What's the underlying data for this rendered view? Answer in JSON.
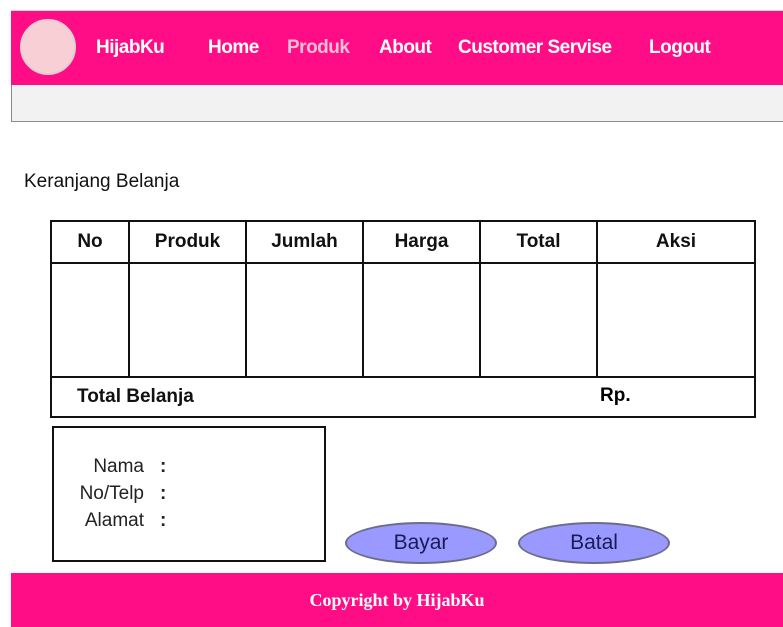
{
  "navbar": {
    "brand": "HijabKu",
    "links": [
      {
        "label": "Home",
        "active": false
      },
      {
        "label": "Produk",
        "active": true
      },
      {
        "label": "About",
        "active": false
      },
      {
        "label": "Customer Servise",
        "active": false
      },
      {
        "label": "Logout",
        "active": false
      }
    ],
    "colors": {
      "background": "#ff0d86",
      "active_link": "#f6bfd6",
      "logo_fill": "#f9cfd6"
    }
  },
  "cart": {
    "title": "Keranjang Belanja",
    "columns": [
      "No",
      "Produk",
      "Jumlah",
      "Harga",
      "Total",
      "Aksi"
    ],
    "total_label": "Total Belanja",
    "total_currency": "Rp."
  },
  "customer": {
    "fields": [
      {
        "label": "Nama",
        "sep": ":"
      },
      {
        "label": "No/Telp",
        "sep": ":"
      },
      {
        "label": "Alamat",
        "sep": ":"
      }
    ]
  },
  "actions": {
    "pay_label": "Bayar",
    "cancel_label": "Batal",
    "button_color": "#9999ff"
  },
  "footer": {
    "text": "Copyright by HijabKu"
  }
}
